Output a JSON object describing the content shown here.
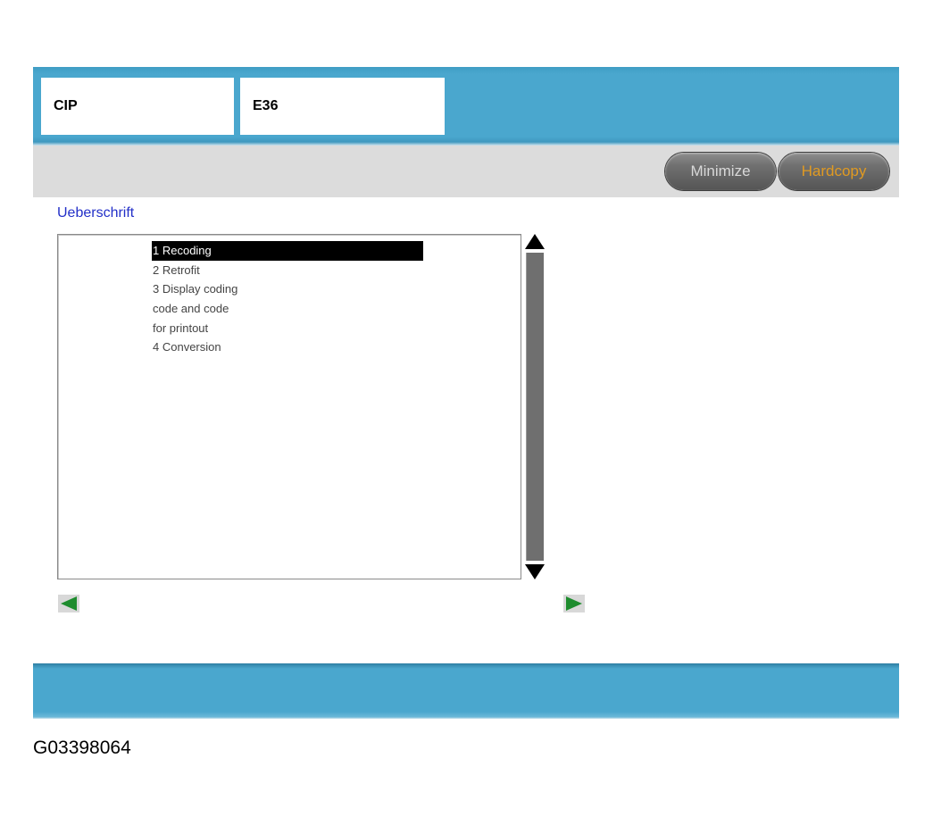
{
  "header": {
    "left_field": "CIP",
    "right_field": "E36"
  },
  "toolbar": {
    "minimize_label": "Minimize",
    "hardcopy_label": "Hardcopy"
  },
  "main": {
    "heading": "Ueberschrift",
    "items": [
      {
        "label": "1 Recoding",
        "selected": true
      },
      {
        "label": "2 Retrofit",
        "selected": false
      },
      {
        "label": "3 Display coding",
        "selected": false
      },
      {
        "label": "code and code",
        "selected": false
      },
      {
        "label": "for printout",
        "selected": false
      },
      {
        "label": "4 Conversion",
        "selected": false
      }
    ]
  },
  "icons": {
    "scroll_up": "triangle-up-icon",
    "scroll_down": "triangle-down-icon",
    "prev": "arrow-left-icon",
    "next": "arrow-right-icon"
  },
  "colors": {
    "header_blue": "#4aa7ce",
    "toolbar_grey": "#dcdcdc",
    "heading_blue": "#2330c8",
    "hardcopy_orange": "#e09a22",
    "nav_green": "#1e8c2e"
  },
  "caption": "G03398064"
}
